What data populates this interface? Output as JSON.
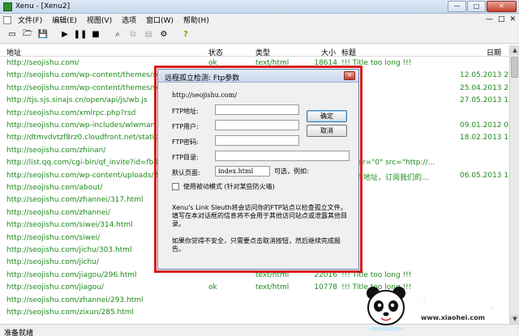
{
  "window": {
    "title": "Xenu - [Xenu2]",
    "min": "—",
    "max": "□",
    "close": "✕"
  },
  "menu": {
    "items": [
      "文件(F)",
      "编辑(E)",
      "视图(V)",
      "选项",
      "窗口(W)",
      "帮助(H)"
    ],
    "mdi_buttons": [
      "—",
      "□",
      "✕"
    ]
  },
  "toolbar": {
    "icons": [
      "new-file-icon",
      "open-folder-icon",
      "save-icon",
      "play-icon",
      "pause-icon",
      "stop-icon",
      "binoculars-icon",
      "copy-icon",
      "properties-icon",
      "settings-icon",
      "help-icon"
    ],
    "glyphs": [
      "▭",
      "🗁",
      "💾",
      "▶",
      "❚❚",
      "■",
      "⌕",
      "⧉",
      "▤",
      "⚙",
      "?"
    ]
  },
  "columns": {
    "url": "地址",
    "status": "状态",
    "type": "类型",
    "size": "大小",
    "title": "标题",
    "date": "日期"
  },
  "rows": [
    {
      "url": "http://seojishu.com/",
      "status": "ok",
      "type": "text/html",
      "size": "18614",
      "title": "!!! Title too long !!!",
      "date": ""
    },
    {
      "url": "http://seojishu.com/wp-content/themes/seojis",
      "status": "",
      "type": "",
      "size": "",
      "title": "",
      "date": "12.05.2013  22"
    },
    {
      "url": "http://seojishu.com/wp-content/themes/seojis",
      "status": "",
      "type": "",
      "size": "",
      "title": "",
      "date": "25.04.2013  23"
    },
    {
      "url": "http://tjs.sjs.sinajs.cn/open/api/js/wb.js",
      "status": "",
      "type": "",
      "size": "",
      "title": "",
      "date": "27.05.2013  15"
    },
    {
      "url": "http://seojishu.com/xmlrpc.php?rsd",
      "status": "",
      "type": "",
      "size": "",
      "title": "",
      "date": ""
    },
    {
      "url": "http://seojishu.com/wp-includes/wlwmanifest.",
      "status": "",
      "type": "",
      "size": "",
      "title": "",
      "date": "09.01.2012  02"
    },
    {
      "url": "http://dtmvdvtzf8rz0.cloudfront.net/static/wp-",
      "status": "",
      "type": "",
      "size": "",
      "title": "",
      "date": "18.02.2013  16"
    },
    {
      "url": "http://seojishu.com/zhinan/",
      "status": "",
      "type": "",
      "size": "",
      "title": "",
      "date": ""
    },
    {
      "url": "http://list.qq.com/cgi-bin/qf_invite?id=fb0dffa",
      "status": "",
      "type": "",
      "size": "",
      "title": "border=\"0\" src=\"http://...",
      "date": ""
    },
    {
      "url": "http://seojishu.com/wp-content/uploads/2013",
      "status": "",
      "type": "",
      "size": "",
      "title": "的邮件地址，订阅我们的...",
      "date": "06.05.2013  15"
    },
    {
      "url": "http://seojishu.com/about/",
      "status": "",
      "type": "",
      "size": "",
      "title": "",
      "date": ""
    },
    {
      "url": "http://seojishu.com/zhannei/317.html",
      "status": "",
      "type": "",
      "size": "",
      "title": "",
      "date": ""
    },
    {
      "url": "http://seojishu.com/zhannei/",
      "status": "",
      "type": "",
      "size": "",
      "title": "",
      "date": ""
    },
    {
      "url": "http://seojishu.com/siwei/314.html",
      "status": "",
      "type": "",
      "size": "",
      "title": "",
      "date": ""
    },
    {
      "url": "http://seojishu.com/siwei/",
      "status": "",
      "type": "",
      "size": "",
      "title": "",
      "date": ""
    },
    {
      "url": "http://seojishu.com/jichu/303.html",
      "status": "",
      "type": "",
      "size": "",
      "title": "",
      "date": ""
    },
    {
      "url": "http://seojishu.com/jichu/",
      "status": "",
      "type": "",
      "size": "",
      "title": "",
      "date": ""
    },
    {
      "url": "http://seojishu.com/jiagou/296.html",
      "status": "",
      "type": "text/html",
      "size": "22016",
      "title": "!!! Title too long !!!",
      "date": ""
    },
    {
      "url": "http://seojishu.com/jiagou/",
      "status": "ok",
      "type": "text/html",
      "size": "10778",
      "title": "!!! Title too long !!!",
      "date": ""
    },
    {
      "url": "http://seojishu.com/zhannei/293.html",
      "status": "",
      "type": "",
      "size": "",
      "title": "",
      "date": ""
    },
    {
      "url": "http://seojishu.com/zixun/285.html",
      "status": "",
      "type": "",
      "size": "",
      "title": "",
      "date": ""
    }
  ],
  "statusbar": {
    "text": "准备就绪"
  },
  "dialog": {
    "title": "远程孤立检测: Ftp参数",
    "close": "✕",
    "host": "http://seojishu.com/",
    "ftp_address_label": "FTP地址:",
    "ftp_user_label": "FTP用户:",
    "ftp_password_label": "FTP密码:",
    "ftp_dir_label": "FTP目录:",
    "default_page_label": "默认页面:",
    "default_page_value": "index.html",
    "optional_label": "可选，例如:",
    "ok_label": "确定",
    "cancel_label": "取消",
    "passive_label": "使用被动模式 (针对某些防火墙)",
    "note1": "Xenu's Link Sleuth将会访问你的FTP站点以检查孤立文件。填写在本对话框的信息将不会用于其他访问站点或泄露其他目录。",
    "note2": "如果你觉得不安全，只需要点击取消按钮，然后继续完成报告。"
  },
  "watermark": {
    "text": "小黑游戏",
    "sub": "www.xiaohei.com"
  },
  "colors": {
    "link_green": "#1d8a1d",
    "highlight_red": "#d81e1e",
    "watermark_blue": "#16a7e0"
  }
}
